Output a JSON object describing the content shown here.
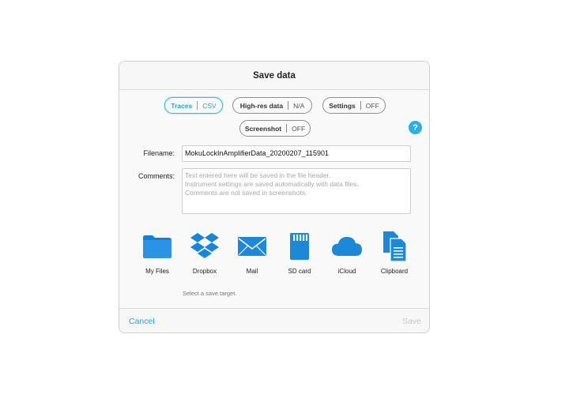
{
  "dialog": {
    "title": "Save data",
    "options": [
      {
        "label": "Traces",
        "value": "CSV",
        "active": true
      },
      {
        "label": "High-res data",
        "value": "N/A",
        "active": false
      },
      {
        "label": "Settings",
        "value": "OFF",
        "active": false
      },
      {
        "label": "Screenshot",
        "value": "OFF",
        "active": false
      }
    ],
    "help_label": "?",
    "filename": {
      "label": "Filename:",
      "value": "MokuLockInAmplifierData_20200207_115901"
    },
    "comments": {
      "label": "Comments:",
      "placeholder_lines": [
        "Text entered here will be saved in the file header.",
        "Instrument settings are saved automatically with data files.",
        "Comments are not saved in screenshots."
      ]
    },
    "targets": [
      {
        "label": "My Files",
        "icon": "folder-icon"
      },
      {
        "label": "Dropbox",
        "icon": "dropbox-icon"
      },
      {
        "label": "Mail",
        "icon": "mail-icon"
      },
      {
        "label": "SD card",
        "icon": "sd-card-icon"
      },
      {
        "label": "iCloud",
        "icon": "icloud-icon"
      },
      {
        "label": "Clipboard",
        "icon": "clipboard-icon"
      }
    ],
    "hint": "Select a save target.",
    "cancel_label": "Cancel",
    "save_label": "Save"
  },
  "colors": {
    "accent": "#1aa7e8",
    "icon_blue": "#1d87d8",
    "disabled": "#c5c5c5"
  }
}
